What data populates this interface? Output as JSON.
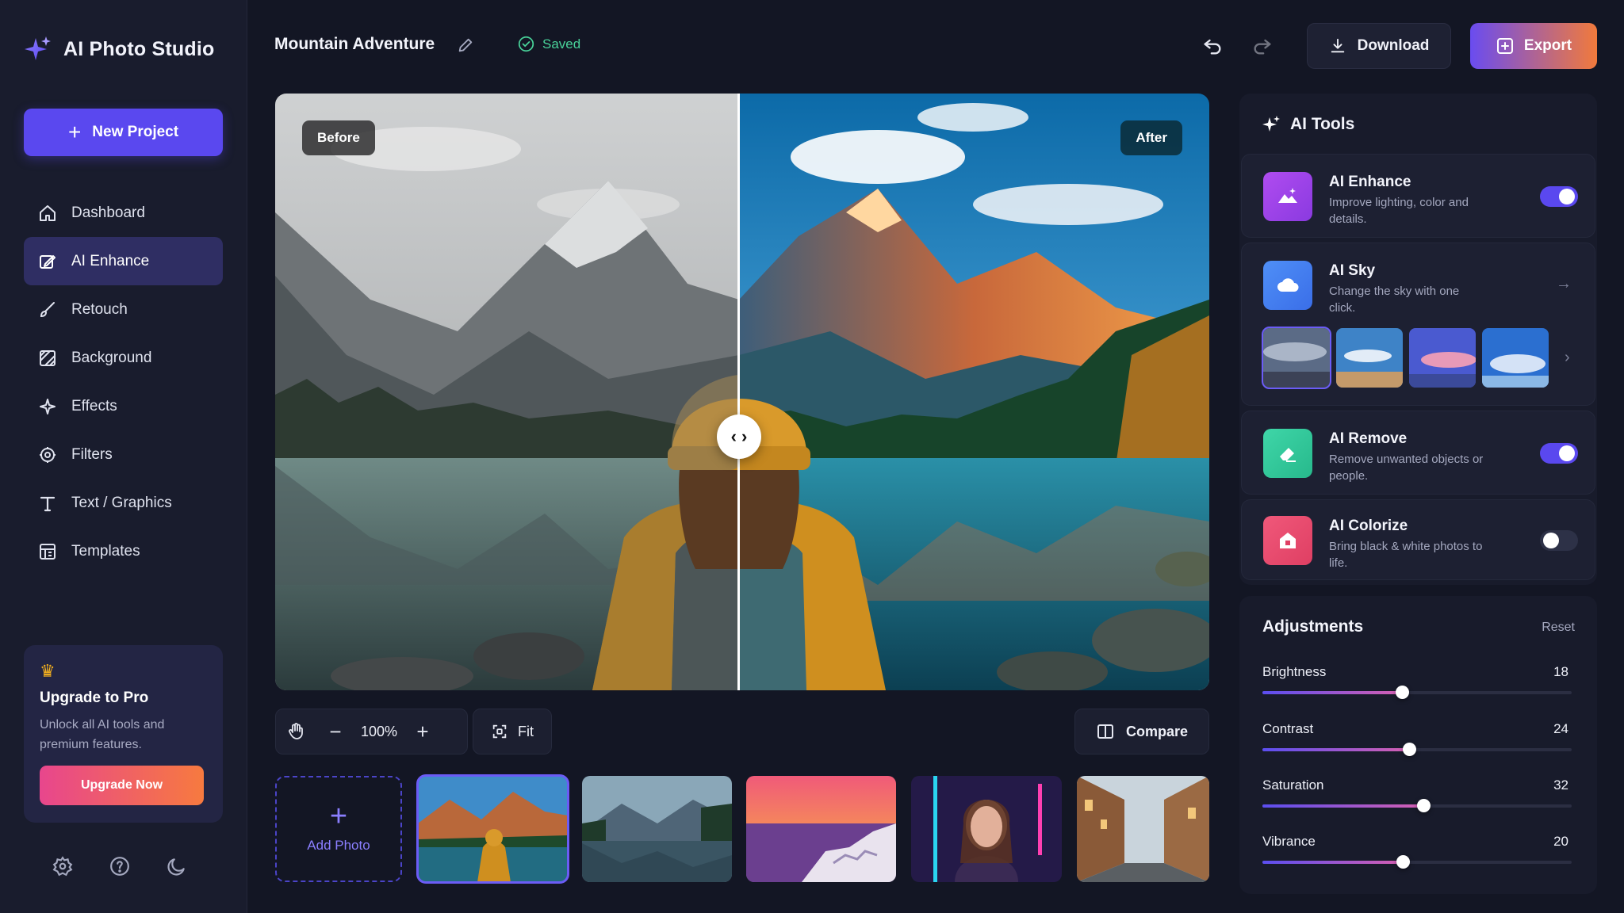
{
  "app": {
    "name": "AI Photo Studio"
  },
  "sidebar": {
    "new_project_label": "New Project",
    "items": [
      {
        "label": "Dashboard",
        "icon": "home-icon"
      },
      {
        "label": "AI Enhance",
        "icon": "magic-edit-icon",
        "active": true
      },
      {
        "label": "Retouch",
        "icon": "brush-icon"
      },
      {
        "label": "Background",
        "icon": "background-icon"
      },
      {
        "label": "Effects",
        "icon": "sparkle-effects-icon"
      },
      {
        "label": "Filters",
        "icon": "filter-icon"
      },
      {
        "label": "Text / Graphics",
        "icon": "text-icon"
      },
      {
        "label": "Templates",
        "icon": "templates-icon"
      }
    ],
    "upgrade": {
      "title": "Upgrade to Pro",
      "description": "Unlock all AI tools and premium features.",
      "button": "Upgrade Now"
    },
    "bottom_icons": [
      "settings-icon",
      "help-icon",
      "dark-mode-icon"
    ]
  },
  "header": {
    "project_title": "Mountain Adventure",
    "status": "Saved",
    "download_label": "Download",
    "export_label": "Export"
  },
  "canvas": {
    "before_label": "Before",
    "after_label": "After",
    "zoom": "100%",
    "fit_label": "Fit",
    "compare_label": "Compare"
  },
  "filmstrip": {
    "add_label": "Add Photo",
    "photos": [
      "mountain-lake-hiker",
      "mountain-lake-forest",
      "coastal-village-sunset",
      "neon-portrait",
      "city-street"
    ]
  },
  "ai_tools": {
    "title": "AI Tools",
    "tools": [
      {
        "name": "AI Enhance",
        "description": "Improve lighting, color and details.",
        "enabled": true
      },
      {
        "name": "AI Sky",
        "description": "Change the sky with one click."
      },
      {
        "name": "AI Remove",
        "description": "Remove unwanted objects or people.",
        "enabled": true
      },
      {
        "name": "AI Colorize",
        "description": "Bring black & white photos to life.",
        "enabled": false
      }
    ]
  },
  "adjustments": {
    "title": "Adjustments",
    "reset_label": "Reset",
    "items": [
      {
        "label": "Brightness",
        "value": "18",
        "level": 0.45
      },
      {
        "label": "Contrast",
        "value": "24",
        "level": 0.475
      },
      {
        "label": "Saturation",
        "value": "32",
        "level": 0.52
      },
      {
        "label": "Vibrance",
        "value": "20",
        "level": 0.455
      }
    ]
  },
  "colors": {
    "accent": "#5a48ef",
    "success": "#49d39a",
    "background": "#131624",
    "panel": "#181b2b"
  }
}
